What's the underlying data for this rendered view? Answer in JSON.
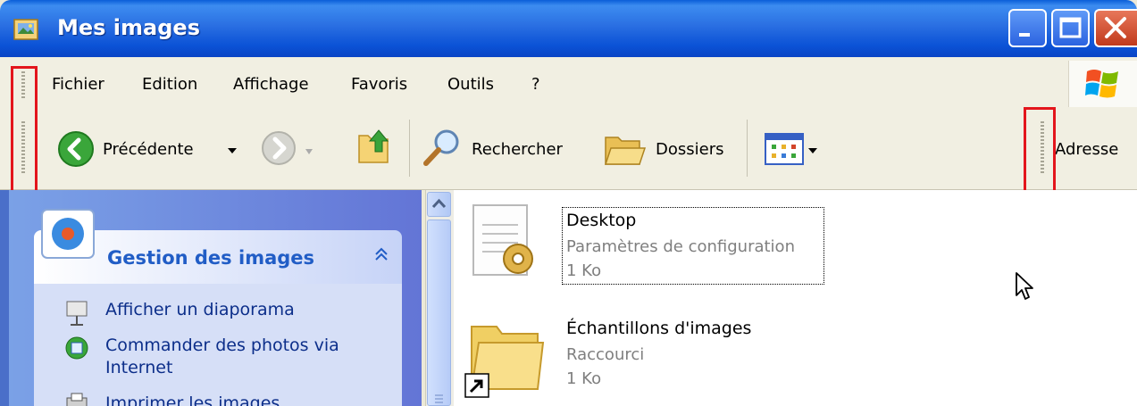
{
  "window": {
    "title": "Mes images"
  },
  "menu": [
    "Fichier",
    "Edition",
    "Affichage",
    "Favoris",
    "Outils",
    "?"
  ],
  "toolbar": {
    "back_label": "Précédente",
    "search_label": "Rechercher",
    "folders_label": "Dossiers",
    "address_label": "Adresse"
  },
  "task_pane": {
    "title": "Gestion des images",
    "items": [
      "Afficher un diaporama",
      "Commander des photos via",
      "Internet",
      "Imprimer les images"
    ]
  },
  "files": [
    {
      "name": "Desktop",
      "type": "Paramètres de configuration",
      "size": "1 Ko"
    },
    {
      "name": "Échantillons d'images",
      "type": "Raccourci",
      "size": "1 Ko"
    }
  ],
  "colors": {
    "titlebar": "#2a6fe2",
    "highlight": "#e3151c",
    "task_title": "#215dc6"
  }
}
